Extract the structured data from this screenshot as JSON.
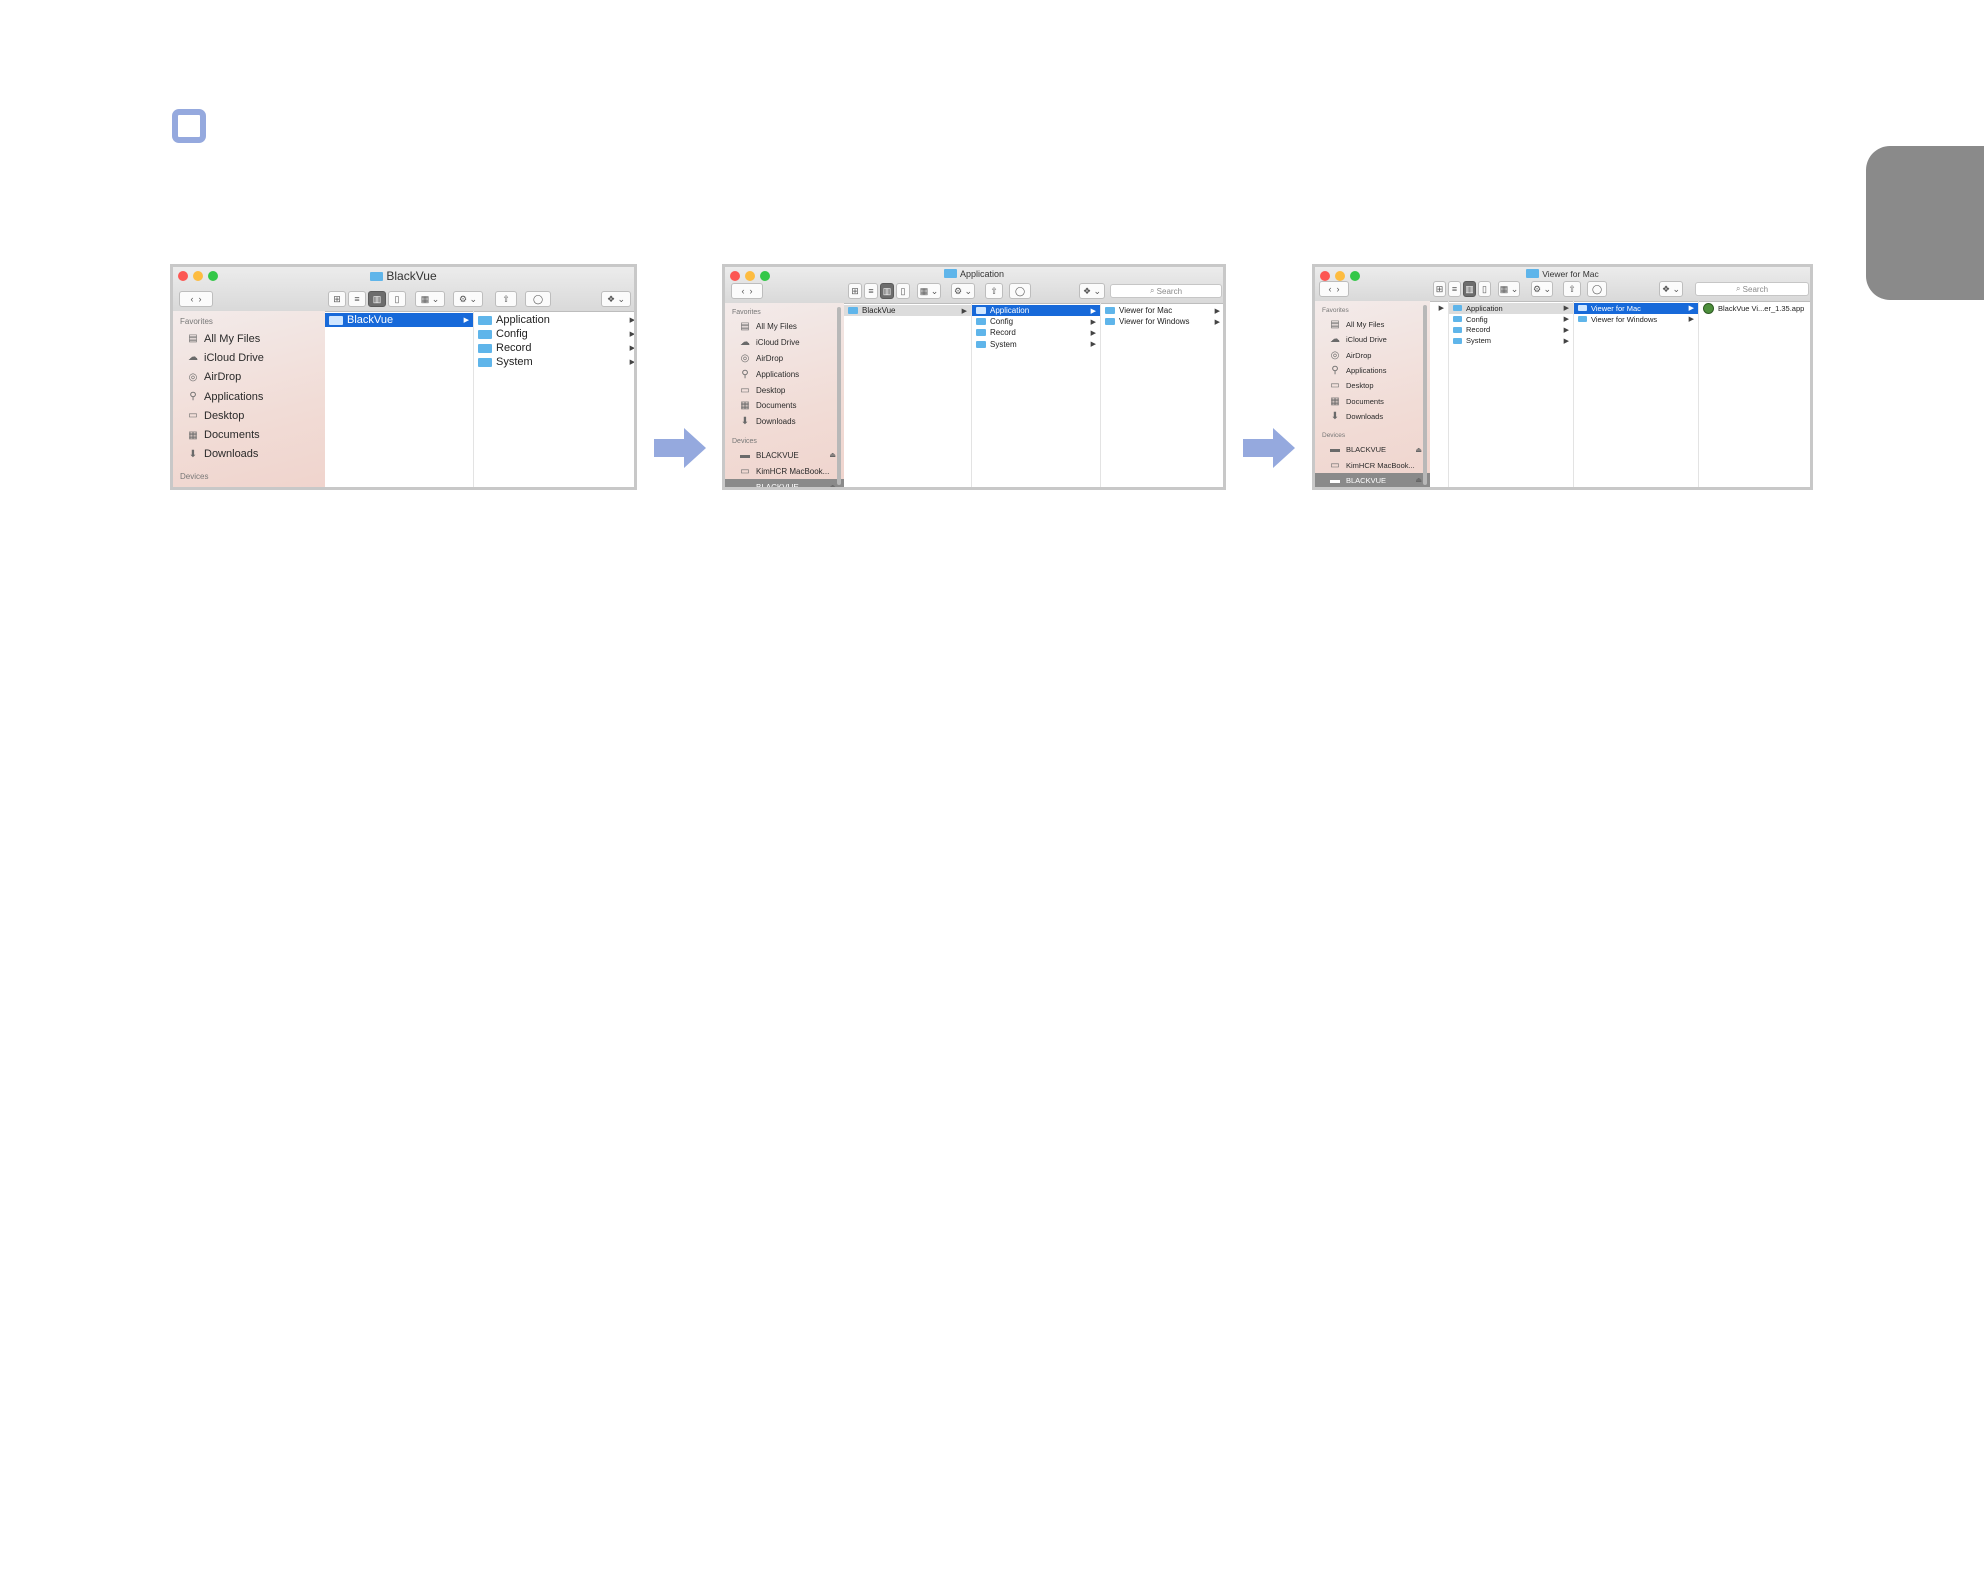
{
  "colors": {
    "accent": "#95a9de",
    "selection": "#1769d9",
    "folder": "#5fb5ea"
  },
  "windows": [
    {
      "title": "BlackVue",
      "search": "",
      "sidebar": {
        "favorites_label": "Favorites",
        "favorites": [
          {
            "label": "All My Files",
            "icon": "all-files-icon"
          },
          {
            "label": "iCloud Drive",
            "icon": "cloud-icon"
          },
          {
            "label": "AirDrop",
            "icon": "airdrop-icon"
          },
          {
            "label": "Applications",
            "icon": "applications-icon"
          },
          {
            "label": "Desktop",
            "icon": "desktop-icon"
          },
          {
            "label": "Documents",
            "icon": "documents-icon"
          },
          {
            "label": "Downloads",
            "icon": "downloads-icon"
          }
        ],
        "devices_label": "Devices",
        "devices": []
      },
      "columns": [
        [
          {
            "label": "BlackVue",
            "selected": true,
            "arrow": true
          }
        ],
        [
          {
            "label": "Application",
            "arrow": true
          },
          {
            "label": "Config",
            "arrow": true
          },
          {
            "label": "Record",
            "arrow": true
          },
          {
            "label": "System",
            "arrow": true
          }
        ]
      ]
    },
    {
      "title": "Application",
      "search": "Search",
      "sidebar": {
        "favorites_label": "Favorites",
        "favorites": [
          {
            "label": "All My Files",
            "icon": "all-files-icon"
          },
          {
            "label": "iCloud Drive",
            "icon": "cloud-icon"
          },
          {
            "label": "AirDrop",
            "icon": "airdrop-icon"
          },
          {
            "label": "Applications",
            "icon": "applications-icon"
          },
          {
            "label": "Desktop",
            "icon": "desktop-icon"
          },
          {
            "label": "Documents",
            "icon": "documents-icon"
          },
          {
            "label": "Downloads",
            "icon": "downloads-icon"
          }
        ],
        "devices_label": "Devices",
        "devices": [
          {
            "label": "BLACKVUE",
            "icon": "drive-icon",
            "eject": true
          },
          {
            "label": "KimHCR MacBook...",
            "icon": "laptop-icon"
          },
          {
            "label": "BLACKVUE",
            "icon": "drive-icon",
            "selected": true,
            "eject": true
          }
        ]
      },
      "columns": [
        [
          {
            "label": "BlackVue",
            "gray": true,
            "arrow": true
          }
        ],
        [
          {
            "label": "Application",
            "selected": true,
            "arrow": true
          },
          {
            "label": "Config",
            "arrow": true
          },
          {
            "label": "Record",
            "arrow": true
          },
          {
            "label": "System",
            "arrow": true
          }
        ],
        [
          {
            "label": "Viewer for Mac",
            "arrow": true
          },
          {
            "label": "Viewer for Windows",
            "arrow": true
          }
        ]
      ]
    },
    {
      "title": "Viewer for Mac",
      "search": "Search",
      "sidebar": {
        "favorites_label": "Favorites",
        "favorites": [
          {
            "label": "All My Files",
            "icon": "all-files-icon"
          },
          {
            "label": "iCloud Drive",
            "icon": "cloud-icon"
          },
          {
            "label": "AirDrop",
            "icon": "airdrop-icon"
          },
          {
            "label": "Applications",
            "icon": "applications-icon"
          },
          {
            "label": "Desktop",
            "icon": "desktop-icon"
          },
          {
            "label": "Documents",
            "icon": "documents-icon"
          },
          {
            "label": "Downloads",
            "icon": "downloads-icon"
          }
        ],
        "devices_label": "Devices",
        "devices": [
          {
            "label": "BLACKVUE",
            "icon": "drive-icon",
            "eject": true
          },
          {
            "label": "KimHCR MacBook...",
            "icon": "laptop-icon"
          },
          {
            "label": "BLACKVUE",
            "icon": "drive-icon",
            "selected": true,
            "eject": true
          }
        ]
      },
      "columns": [
        [
          {
            "label": "",
            "arrow": true
          }
        ],
        [
          {
            "label": "Application",
            "gray": true,
            "arrow": true
          },
          {
            "label": "Config",
            "arrow": true
          },
          {
            "label": "Record",
            "arrow": true
          },
          {
            "label": "System",
            "arrow": true
          }
        ],
        [
          {
            "label": "Viewer for Mac",
            "selected": true,
            "arrow": true
          },
          {
            "label": "Viewer for Windows",
            "arrow": true
          }
        ],
        [
          {
            "label": "BlackVue Vi...er_1.35.app",
            "app": true
          }
        ]
      ]
    }
  ]
}
